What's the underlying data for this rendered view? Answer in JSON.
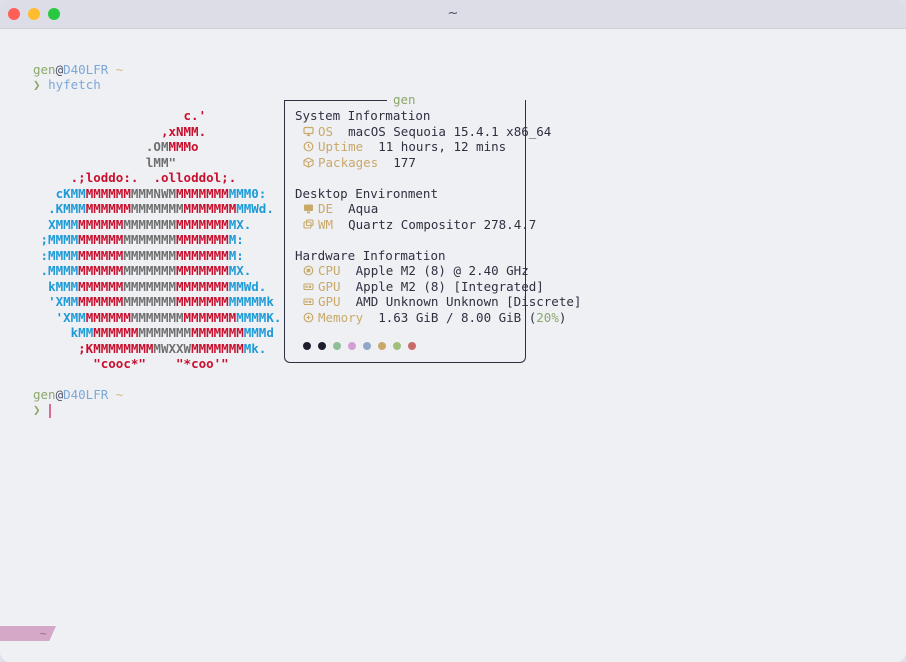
{
  "window": {
    "title": "~"
  },
  "prompt1": {
    "user": "gen",
    "at": "@",
    "host": "D40LFR",
    "dir": "~",
    "arrow": "❯",
    "command": "hyfetch"
  },
  "prompt2": {
    "user": "gen",
    "at": "@",
    "host": "D40LFR",
    "dir": "~",
    "arrow": "❯"
  },
  "logo_lines": [
    [
      [
        "                    ",
        "c-dark"
      ],
      [
        "c.'",
        "c-red"
      ]
    ],
    [
      [
        "                 ",
        "c-dark"
      ],
      [
        ",xNMM.",
        "c-red"
      ]
    ],
    [
      [
        "               ",
        "c-dark"
      ],
      [
        ".OM",
        "c-gray"
      ],
      [
        "MMMo",
        "c-red"
      ]
    ],
    [
      [
        "               ",
        "c-dark"
      ],
      [
        "lMM\"",
        "c-gray"
      ]
    ],
    [
      [
        "     ",
        "c-dark"
      ],
      [
        ".;loddo:.",
        "c-red"
      ],
      [
        "  ",
        "c-dark"
      ],
      [
        ".olloddol;.",
        "c-red"
      ]
    ],
    [
      [
        "   ",
        "c-dark"
      ],
      [
        "cKMM",
        "c-blue"
      ],
      [
        "MMMMMM",
        "c-red"
      ],
      [
        "MMMNWM",
        "c-gray"
      ],
      [
        "MMMMMMM",
        "c-red"
      ],
      [
        "MMM0:",
        "c-blue"
      ]
    ],
    [
      [
        "  ",
        "c-dark"
      ],
      [
        ".KMMM",
        "c-blue"
      ],
      [
        "MMMMMM",
        "c-red"
      ],
      [
        "MMMMMMM",
        "c-gray"
      ],
      [
        "MMMMMMM",
        "c-red"
      ],
      [
        "MMWd.",
        "c-blue"
      ]
    ],
    [
      [
        "  ",
        "c-dark"
      ],
      [
        "XMMM",
        "c-blue"
      ],
      [
        "MMMMMM",
        "c-red"
      ],
      [
        "MMMMMMM",
        "c-gray"
      ],
      [
        "MMMMMMM",
        "c-red"
      ],
      [
        "MX.",
        "c-blue"
      ]
    ],
    [
      [
        " ",
        "c-dark"
      ],
      [
        ";MMMM",
        "c-blue"
      ],
      [
        "MMMMMM",
        "c-red"
      ],
      [
        "MMMMMMM",
        "c-gray"
      ],
      [
        "MMMMMMM",
        "c-red"
      ],
      [
        "M:",
        "c-blue"
      ]
    ],
    [
      [
        " ",
        "c-dark"
      ],
      [
        ":MMMM",
        "c-blue"
      ],
      [
        "MMMMMM",
        "c-red"
      ],
      [
        "MMMMMMM",
        "c-gray"
      ],
      [
        "MMMMMMM",
        "c-red"
      ],
      [
        "M:",
        "c-blue"
      ]
    ],
    [
      [
        " ",
        "c-dark"
      ],
      [
        ".MMMM",
        "c-blue"
      ],
      [
        "MMMMMM",
        "c-red"
      ],
      [
        "MMMMMMM",
        "c-gray"
      ],
      [
        "MMMMMMM",
        "c-red"
      ],
      [
        "MX.",
        "c-blue"
      ]
    ],
    [
      [
        "  ",
        "c-dark"
      ],
      [
        "kMMM",
        "c-blue"
      ],
      [
        "MMMMMM",
        "c-red"
      ],
      [
        "MMMMMMM",
        "c-gray"
      ],
      [
        "MMMMMMM",
        "c-red"
      ],
      [
        "MMWd.",
        "c-blue"
      ]
    ],
    [
      [
        "  ",
        "c-dark"
      ],
      [
        "'XMM",
        "c-blue"
      ],
      [
        "MMMMMM",
        "c-red"
      ],
      [
        "MMMMMMM",
        "c-gray"
      ],
      [
        "MMMMMMM",
        "c-red"
      ],
      [
        "MMMMMk",
        "c-blue"
      ]
    ],
    [
      [
        "   ",
        "c-dark"
      ],
      [
        "'XMM",
        "c-blue"
      ],
      [
        "MMMMMM",
        "c-red"
      ],
      [
        "MMMMMMM",
        "c-gray"
      ],
      [
        "MMMMMMM",
        "c-red"
      ],
      [
        "MMMMK.",
        "c-blue"
      ]
    ],
    [
      [
        "     ",
        "c-dark"
      ],
      [
        "kMM",
        "c-blue"
      ],
      [
        "MMMMMM",
        "c-red"
      ],
      [
        "MMMMMMM",
        "c-gray"
      ],
      [
        "MMMMMMM",
        "c-red"
      ],
      [
        "MMMd",
        "c-blue"
      ]
    ],
    [
      [
        "      ",
        "c-dark"
      ],
      [
        ";KMM",
        "c-red"
      ],
      [
        "MMMMMM",
        "c-red"
      ],
      [
        "MWXXW",
        "c-gray"
      ],
      [
        "MMMMMMM",
        "c-red"
      ],
      [
        "Mk.",
        "c-blue"
      ]
    ],
    [
      [
        "        ",
        "c-dark"
      ],
      [
        "\"cooc*\"",
        "c-red"
      ],
      [
        "    ",
        "c-dark"
      ],
      [
        "\"*coo'\"",
        "c-red"
      ]
    ]
  ],
  "fetch": {
    "header": "gen",
    "sections": [
      {
        "title": "System Information",
        "rows": [
          {
            "icon": "monitor-icon",
            "key": "OS",
            "value": "macOS Sequoia 15.4.1 x86_64"
          },
          {
            "icon": "clock-icon",
            "key": "Uptime",
            "value": "11 hours, 12 mins"
          },
          {
            "icon": "package-icon",
            "key": "Packages",
            "value": "177"
          }
        ]
      },
      {
        "title": "Desktop Environment",
        "rows": [
          {
            "icon": "desktop-icon",
            "key": "DE",
            "value": "Aqua"
          },
          {
            "icon": "window-icon",
            "key": "WM",
            "value": "Quartz Compositor 278.4.7"
          }
        ]
      },
      {
        "title": "Hardware Information",
        "rows": [
          {
            "icon": "cpu-icon",
            "key": "CPU",
            "value": "Apple M2 (8) @ 2.40 GHz"
          },
          {
            "icon": "gpu-icon",
            "key": "GPU",
            "value": "Apple M2 (8) [Integrated]"
          },
          {
            "icon": "gpu-icon",
            "key": "GPU",
            "value": "AMD Unknown Unknown [Discrete]"
          },
          {
            "icon": "memory-icon",
            "key": "Memory",
            "value": "1.63 GiB / 8.00 GiB (",
            "pct": "20%",
            "suffix": ")"
          }
        ]
      }
    ],
    "palette": [
      "#1e1e2e",
      "#1e1e2e",
      "#8fbf98",
      "#d49ed3",
      "#8fa8c8",
      "#c9a96a",
      "#9fbf7a",
      "#c96b6b"
    ]
  },
  "statusbar": {
    "label": "~"
  }
}
